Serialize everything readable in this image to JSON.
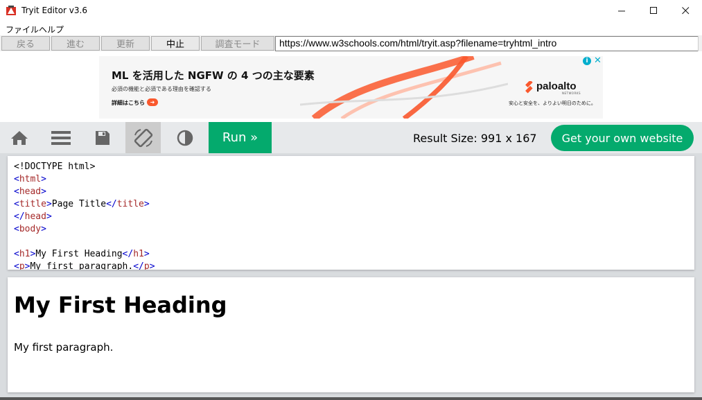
{
  "window": {
    "title": "Tryit Editor v3.6",
    "minimize_glyph": "—",
    "maximize_glyph": "☐",
    "close_glyph": "✕"
  },
  "menu": {
    "items": [
      {
        "label": "ファイル"
      },
      {
        "label": "ヘルプ"
      }
    ]
  },
  "nav": {
    "back_label": "戻る",
    "forward_label": "進む",
    "refresh_label": "更新",
    "stop_label": "中止",
    "debug_label": "調査モード",
    "url_value": "https://www.w3schools.com/html/tryit.asp?filename=tryhtml_intro"
  },
  "ad": {
    "title": "ML を活用した NGFW の 4 つの主な要素",
    "subtitle": "必須の機能と必須である理由を確認する",
    "cta": "詳細はこちら",
    "logo_text": "paloalto",
    "logo_sub": "NETWORKS",
    "tagline": "安心と安全を、よりよい明日のために。",
    "info_glyph": "i",
    "close_glyph": "✕",
    "accent_color": "#fa582d"
  },
  "toolbar": {
    "icons": [
      "home-icon",
      "menu-icon",
      "save-icon",
      "rotate-icon",
      "contrast-icon"
    ],
    "run_label": "Run »",
    "result_size_text": "Result Size: 991 x 167",
    "get_website_label": "Get your own website",
    "accent_color": "#04aa6d"
  },
  "code": {
    "lines": [
      {
        "parts": [
          {
            "t": "<!DOCTYPE html>",
            "c": "plain"
          }
        ]
      },
      {
        "parts": [
          {
            "t": "<",
            "c": "b"
          },
          {
            "t": "html",
            "c": "tag"
          },
          {
            "t": ">",
            "c": "b"
          }
        ]
      },
      {
        "parts": [
          {
            "t": "<",
            "c": "b"
          },
          {
            "t": "head",
            "c": "tag"
          },
          {
            "t": ">",
            "c": "b"
          }
        ]
      },
      {
        "parts": [
          {
            "t": "<",
            "c": "b"
          },
          {
            "t": "title",
            "c": "tag"
          },
          {
            "t": ">",
            "c": "b"
          },
          {
            "t": "Page Title",
            "c": "plain"
          },
          {
            "t": "</",
            "c": "b"
          },
          {
            "t": "title",
            "c": "tag"
          },
          {
            "t": ">",
            "c": "b"
          }
        ]
      },
      {
        "parts": [
          {
            "t": "</",
            "c": "b"
          },
          {
            "t": "head",
            "c": "tag"
          },
          {
            "t": ">",
            "c": "b"
          }
        ]
      },
      {
        "parts": [
          {
            "t": "<",
            "c": "b"
          },
          {
            "t": "body",
            "c": "tag"
          },
          {
            "t": ">",
            "c": "b"
          }
        ]
      },
      {
        "parts": []
      },
      {
        "parts": [
          {
            "t": "<",
            "c": "b"
          },
          {
            "t": "h1",
            "c": "tag"
          },
          {
            "t": ">",
            "c": "b"
          },
          {
            "t": "My First Heading",
            "c": "plain"
          },
          {
            "t": "</",
            "c": "b"
          },
          {
            "t": "h1",
            "c": "tag"
          },
          {
            "t": ">",
            "c": "b"
          }
        ]
      },
      {
        "parts": [
          {
            "t": "<",
            "c": "b"
          },
          {
            "t": "p",
            "c": "tag"
          },
          {
            "t": ">",
            "c": "b"
          },
          {
            "t": "My first paragraph.",
            "c": "plain"
          },
          {
            "t": "</",
            "c": "b"
          },
          {
            "t": "p",
            "c": "tag"
          },
          {
            "t": ">",
            "c": "b"
          }
        ]
      }
    ]
  },
  "result": {
    "heading": "My First Heading",
    "paragraph": "My first paragraph."
  }
}
